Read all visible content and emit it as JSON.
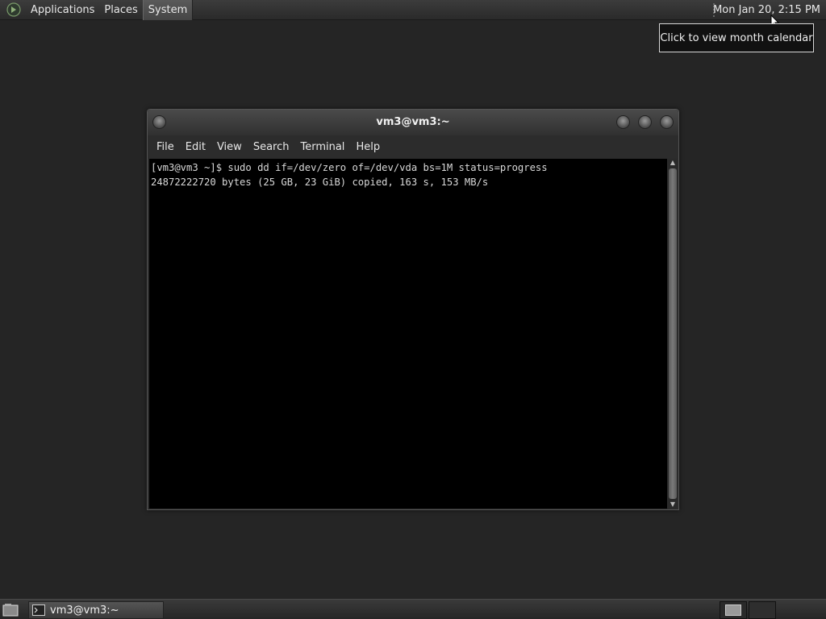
{
  "top_panel": {
    "menus": [
      "Applications",
      "Places",
      "System"
    ],
    "clock": "Mon Jan 20,  2:15 PM"
  },
  "tooltip": {
    "text": "Click to view month calendar"
  },
  "window": {
    "title": "vm3@vm3:~",
    "menu": [
      "File",
      "Edit",
      "View",
      "Search",
      "Terminal",
      "Help"
    ],
    "terminal_lines": [
      "[vm3@vm3 ~]$ sudo dd if=/dev/zero of=/dev/vda bs=1M status=progress",
      "24872222720 bytes (25 GB, 23 GiB) copied, 163 s, 153 MB/s"
    ]
  },
  "taskbar": {
    "task_label": "vm3@vm3:~"
  },
  "icons": {
    "logo": "gnome-foot-icon",
    "close": "close-icon",
    "minimize": "minimize-icon",
    "maximize": "maximize-icon",
    "terminal": "terminal-icon",
    "desktop": "show-desktop-icon"
  }
}
